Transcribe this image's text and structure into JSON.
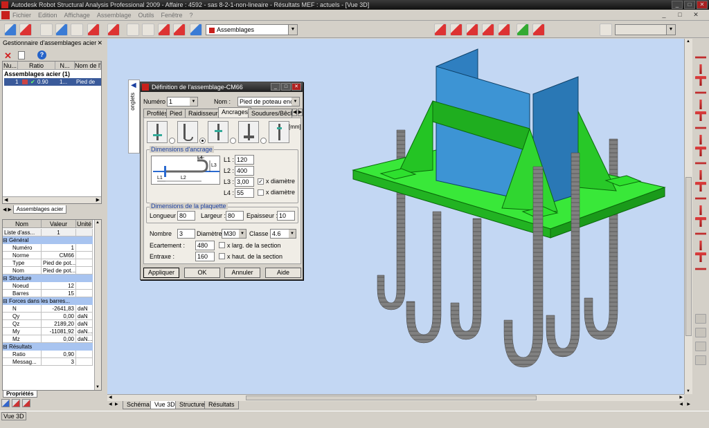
{
  "window": {
    "title": "Autodesk Robot Structural Analysis Professional 2009 - Affaire : 4592 - sas 8-2-1-non-lineaire - Résultats MEF : actuels - [Vue 3D]",
    "controls": [
      "_",
      "□",
      "✕"
    ]
  },
  "menu": {
    "items": [
      "Fichier",
      "Edition",
      "Affichage",
      "Assemblage",
      "Outils",
      "Fenêtre",
      "?"
    ],
    "mdi_controls": [
      "_",
      "□",
      "✕"
    ]
  },
  "toolbar": {
    "combo_value": "Assemblages",
    "combo2_value": ""
  },
  "manager": {
    "title": "Gestionnaire d'assemblages acier",
    "columns": [
      "Nu...",
      "Ratio",
      "N...",
      "Nom de l'a"
    ],
    "group_label": "Assemblages acier (1)",
    "row": {
      "num": "1",
      "ratio": "0.90",
      "n": "1...",
      "name": "Pied de pot"
    },
    "tab_label": "Assemblages acier"
  },
  "props": {
    "columns": [
      "Nom",
      "Valeur",
      "Unité"
    ],
    "list_row": {
      "name": "Liste d'ass...",
      "value": "1",
      "unit": ""
    },
    "sections": [
      {
        "title": "Général",
        "rows": [
          {
            "name": "Numéro",
            "value": "1",
            "unit": ""
          },
          {
            "name": "Norme",
            "value": "CM66",
            "unit": ""
          },
          {
            "name": "Type",
            "value": "Pied de pot...",
            "unit": ""
          },
          {
            "name": "Nom",
            "value": "Pied de pot...",
            "unit": ""
          }
        ]
      },
      {
        "title": "Structure",
        "rows": [
          {
            "name": "Noeud",
            "value": "12",
            "unit": ""
          },
          {
            "name": "Barres",
            "value": "15",
            "unit": ""
          }
        ]
      },
      {
        "title": "Forces dans les barres...",
        "rows": [
          {
            "name": "N",
            "value": "-2641,83",
            "unit": "daN"
          },
          {
            "name": "Qy",
            "value": "0,00",
            "unit": "daN"
          },
          {
            "name": "Qz",
            "value": "2189,20",
            "unit": "daN"
          },
          {
            "name": "My",
            "value": "-11081,92",
            "unit": "daN..."
          },
          {
            "name": "Mz",
            "value": "0,00",
            "unit": "daN..."
          }
        ]
      },
      {
        "title": "Résultats",
        "rows": [
          {
            "name": "Ratio",
            "value": "0,90",
            "unit": ""
          },
          {
            "name": "Messag...",
            "value": "3",
            "unit": ""
          }
        ]
      }
    ],
    "tab_label": "Propriétés"
  },
  "onglets_label": "onglets",
  "dialog": {
    "title": "Définition de l'assemblage-CM66",
    "numero_label": "Numéro :",
    "numero_value": "1",
    "nom_label": "Nom :",
    "nom_value": "Pied de poteau enca",
    "tabs": [
      "Profilés",
      "Pied",
      "Raidisseurs",
      "Ancrages",
      "Soudures/Bêche"
    ],
    "active_tab": "Ancrages",
    "unit_label": "[mm]",
    "anchorage_group": "Dimensions d'ancrage",
    "diagram_labels": {
      "l1": "L1",
      "l2": "L2",
      "l3": "L3",
      "l4": "L4"
    },
    "L1": {
      "label": "L1 :",
      "value": "120"
    },
    "L2": {
      "label": "L2 :",
      "value": "400"
    },
    "L3": {
      "label": "L3 :",
      "value": "3,00",
      "check_label": "x diamètre",
      "checked": true
    },
    "L4": {
      "label": "L4 :",
      "value": "55",
      "check_label": "x diamètre",
      "checked": false
    },
    "plate_group": "Dimensions de la plaquette",
    "longueur": {
      "label": "Longueur",
      "value": "80"
    },
    "largeur": {
      "label": "Largeur :",
      "value": "80"
    },
    "epaisseur": {
      "label": "Epaisseur :",
      "value": "10"
    },
    "nombre": {
      "label": "Nombre",
      "value": "3"
    },
    "diametre": {
      "label": "Diamètre :",
      "value": "M30"
    },
    "classe": {
      "label": "Classe :",
      "value": "4.6"
    },
    "ecartement": {
      "label": "Ecartement :",
      "value": "480",
      "check_label": "x larg. de la section"
    },
    "entraxe": {
      "label": "Entraxe :",
      "value": "160",
      "check_label": "x haut. de la section"
    },
    "buttons": {
      "apply": "Appliquer",
      "ok": "OK",
      "cancel": "Annuler",
      "help": "Aide"
    }
  },
  "view_tabs": [
    "Schéma",
    "Vue 3D",
    "Structure",
    "Résultats"
  ],
  "active_view_tab": "Vue 3D",
  "status": "Vue 3D",
  "colors": {
    "plate": "#2ed82e",
    "column": "#3f8fc9",
    "bolt": "#7c7c7c",
    "viewport": "#c3d7f3"
  }
}
